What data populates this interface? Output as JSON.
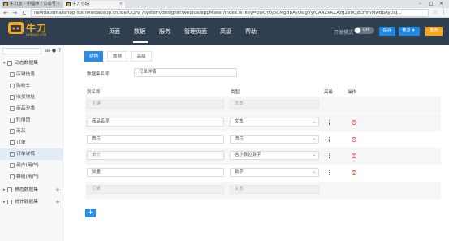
{
  "browser": {
    "tabs": [
      {
        "label": "牛刀云 - 小程序 / 公众号",
        "close": "×"
      },
      {
        "label": "牛刀小说",
        "close": "×"
      }
    ],
    "url": "newdaosmallshop-ide.newdaoapp.cn/ide/UI2/v_/system/designer/webIde/appMaker/index.w?key=bwQrOJ5CMgBbAyUsIgVyfCA4ZxRZAzg2e0QjB3hmMw8bAyUsJ...",
    "controls": {
      "back": "←",
      "forward": "→",
      "reload": "C",
      "star": "☆",
      "menu": "⋮",
      "min": "–",
      "max": "□",
      "close": "×"
    }
  },
  "header": {
    "logo": "牛刀",
    "logo_sub": "NEWDAO.COM",
    "nav": [
      "页面",
      "数据",
      "服务",
      "管理页面",
      "高级",
      "帮助"
    ],
    "active_nav": "数据",
    "dev_mode_label": "开发模式",
    "toggle_label": "OFF",
    "save": "保存",
    "preview": "预览",
    "preview_caret": "▾",
    "publish": "发布"
  },
  "sidebar": {
    "tools": [
      "⊞",
      "●",
      "?"
    ],
    "items": [
      {
        "label": "动态数据集",
        "type": "group",
        "arrow": "▾"
      },
      {
        "label": "店铺信息",
        "type": "child"
      },
      {
        "label": "购物车",
        "type": "child"
      },
      {
        "label": "收货地址",
        "type": "child"
      },
      {
        "label": "商品分类",
        "type": "child"
      },
      {
        "label": "轮播图",
        "type": "child"
      },
      {
        "label": "商品",
        "type": "child"
      },
      {
        "label": "订单",
        "type": "child"
      },
      {
        "label": "订单详情",
        "type": "child",
        "active": true
      },
      {
        "label": "用户(用户)",
        "type": "child"
      },
      {
        "label": "群组(用户)",
        "type": "child"
      },
      {
        "label": "静态数据集",
        "type": "group",
        "arrow": "▸"
      },
      {
        "label": "统计数据集",
        "type": "group",
        "arrow": "▸"
      }
    ],
    "plus": "+"
  },
  "content": {
    "tabs": [
      "结构",
      "数据",
      "高级"
    ],
    "active_tab": "结构",
    "name_label": "数据集名称:",
    "name_value": "订单详情",
    "columns": {
      "name": "列名称",
      "type": "类型",
      "advanced": "高级",
      "action": "操作"
    },
    "rows": [
      {
        "name": "主键",
        "type": "文本",
        "disabled": true
      },
      {
        "name": "商品名称",
        "type": "文本"
      },
      {
        "name": "图片",
        "type": "图片"
      },
      {
        "name": "单价",
        "type": "含小数位数字",
        "name_placeholder": true
      },
      {
        "name": "数量",
        "type": "数字"
      },
      {
        "name": "订单",
        "type": "文本",
        "disabled": true
      }
    ],
    "add_button": "+",
    "delete_icon": "×"
  }
}
